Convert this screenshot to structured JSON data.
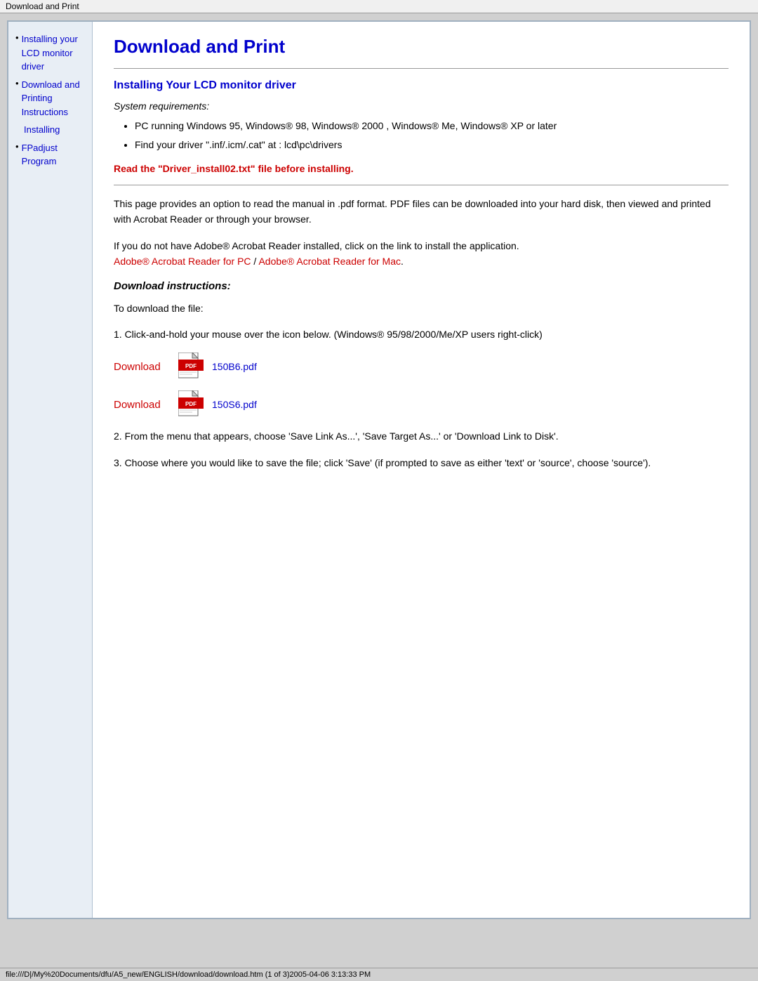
{
  "titleBar": {
    "text": "Download and Print"
  },
  "sidebar": {
    "items": [
      {
        "label": "Installing your LCD monitor driver",
        "bullet": "•"
      },
      {
        "label": "Download and Printing Instructions",
        "bullet": "•"
      },
      {
        "label": "Installing",
        "bullet": ""
      },
      {
        "label": "FPadjust Program",
        "bullet": "•"
      }
    ]
  },
  "content": {
    "pageTitle": "Download and Print",
    "sectionHeading": "Installing Your LCD monitor driver",
    "systemReqLabel": "System requirements:",
    "bullets": [
      "PC running Windows 95, Windows® 98, Windows® 2000 , Windows® Me, Windows® XP or later",
      "Find your driver \".inf/.icm/.cat\" at : lcd\\pc\\drivers"
    ],
    "warningText": "Read the \"Driver_install02.txt\" file before installing.",
    "paragraph1": "This page provides an option to read the manual in .pdf format. PDF files can be downloaded into your hard disk, then viewed and printed with Acrobat Reader or through your browser.",
    "paragraph2_prefix": "If you do not have Adobe® Acrobat Reader installed, click on the link to install the application.",
    "acrobatLinkPC": "Adobe® Acrobat Reader for PC",
    "acrobatLinkSep": " / ",
    "acrobatLinkMac": "Adobe® Acrobat Reader for Mac",
    "downloadInstructionsHeading": "Download instructions:",
    "toDownloadText": "To download the file:",
    "step1": "1. Click-and-hold your mouse over the icon below. (Windows® 95/98/2000/Me/XP users right-click)",
    "downloadRows": [
      {
        "downloadLabel": "Download",
        "pdfFile": "150B6.pdf"
      },
      {
        "downloadLabel": "Download",
        "pdfFile": "150S6.pdf"
      }
    ],
    "step2": "2. From the menu that appears, choose 'Save Link As...', 'Save Target As...' or 'Download Link to Disk'.",
    "step3": "3. Choose where you would like to save the file; click 'Save' (if prompted to save as either 'text' or 'source', choose 'source')."
  },
  "statusBar": {
    "text": "file:///D|/My%20Documents/dfu/A5_new/ENGLISH/download/download.htm (1 of 3)2005-04-06 3:13:33 PM"
  }
}
